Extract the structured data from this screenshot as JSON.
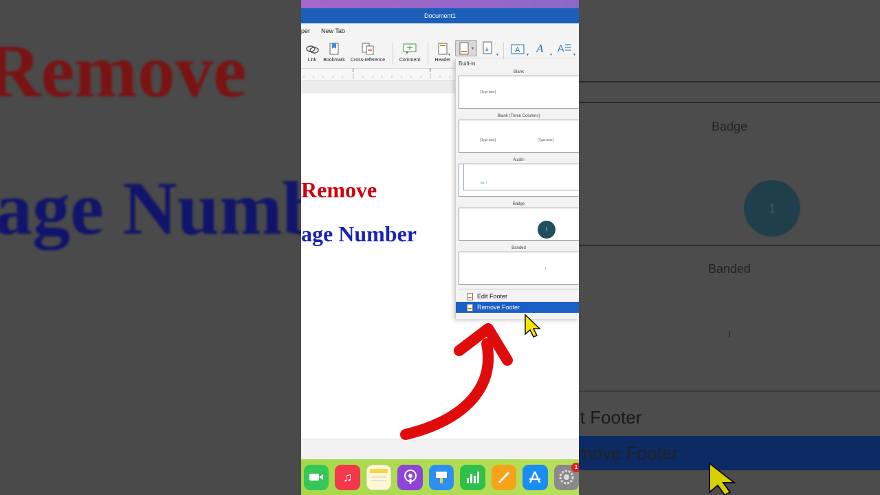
{
  "background": {
    "left_text_1": "Remove",
    "left_text_2": "age Numb",
    "right_labels": {
      "badge": "Badge",
      "badge_number": "1",
      "banded": "Banded",
      "banded_mark": "I"
    },
    "right_menu": {
      "edit": "it Footer",
      "remove": "move Footer"
    }
  },
  "window": {
    "title": "Document1"
  },
  "tabs": [
    "per",
    "New Tab"
  ],
  "ribbon": {
    "link": "Link",
    "bookmark": "Bookmark",
    "cross_reference": "Cross-reference",
    "comment": "Comment",
    "header": "Header"
  },
  "ruler": {
    "mark_2": "2",
    "mark_3": "3"
  },
  "document": {
    "line1": "Remove",
    "line2": "age Number"
  },
  "footer_menu": {
    "section": "Built-in",
    "gallery": [
      {
        "title": "Blank",
        "placeholders": [
          "[Type here]"
        ]
      },
      {
        "title": "Blank (Three Columns)",
        "placeholders": [
          "[Type here]",
          "[Type here]"
        ]
      },
      {
        "title": "Austin",
        "placeholders": [
          "pg. 1"
        ]
      },
      {
        "title": "Badge",
        "placeholders": [
          "1"
        ]
      },
      {
        "title": "Banded",
        "placeholders": [
          "1"
        ]
      }
    ],
    "items": [
      {
        "label": "Edit Footer",
        "highlighted": false
      },
      {
        "label": "Remove Footer",
        "highlighted": true
      }
    ]
  },
  "dock": {
    "apps": [
      "FaceTime",
      "Music",
      "Notes",
      "Podcasts",
      "Keynote",
      "Numbers",
      "Pages",
      "App Store",
      "System Settings"
    ],
    "settings_badge": "1"
  },
  "colors": {
    "accent": "#1c5fc6",
    "title_bar": "#1b5fb8",
    "red_text": "#d0000c",
    "blue_text": "#1a23b8",
    "arrow": "#e00c0c"
  }
}
